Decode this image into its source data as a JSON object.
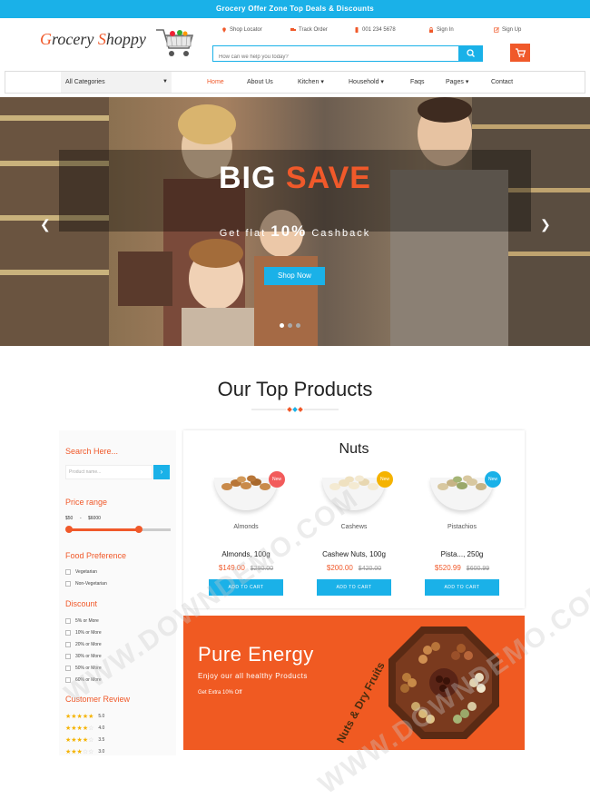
{
  "topbar": {
    "text": "Grocery Offer Zone Top Deals & Discounts"
  },
  "logo": {
    "part1": "G",
    "part2": "rocery ",
    "part3": "S",
    "part4": "hoppy"
  },
  "header_links": {
    "shop_locator": "Shop Locator",
    "track_order": "Track Order",
    "phone": "001 234 5678",
    "sign_in": "Sign In",
    "sign_up": "Sign Up"
  },
  "search": {
    "placeholder": "How can we help you today?"
  },
  "nav": {
    "category": "All Categories",
    "items": [
      "Home",
      "About Us",
      "Kitchen",
      "Household",
      "Faqs",
      "Pages",
      "Contact"
    ]
  },
  "hero": {
    "title_big": "BIG",
    "title_save": "SAVE",
    "sub_prefix": "Get flat",
    "sub_pct": "10%",
    "sub_suffix": "Cashback",
    "button": "Shop Now"
  },
  "section_title": "Our Top Products",
  "sidebar": {
    "search_heading": "Search Here...",
    "search_placeholder": "Product name...",
    "price_heading": "Price range",
    "price_min": "$50",
    "price_dash": "-",
    "price_max": "$6000",
    "food_heading": "Food Preference",
    "food_options": [
      "Vegetarian",
      "Non-Vegetarian"
    ],
    "discount_heading": "Discount",
    "discount_options": [
      "5% or More",
      "10% or More",
      "20% or More",
      "30% or More",
      "50% or More",
      "60% or More"
    ],
    "review_heading": "Customer Review",
    "reviews": [
      "5.0",
      "4.0",
      "3.5",
      "3.0"
    ]
  },
  "products": {
    "heading": "Nuts",
    "badge": "New",
    "button": "ADD TO CART",
    "items": [
      {
        "caption": "Almonds",
        "name": "Almonds, 100g",
        "price": "$149.00",
        "old_price": "$280.00"
      },
      {
        "caption": "Cashews",
        "name": "Cashew Nuts, 100g",
        "price": "$200.00",
        "old_price": "$420.00"
      },
      {
        "caption": "Pistachios",
        "name": "Pista..., 250g",
        "price": "$520.99",
        "old_price": "$600.99"
      }
    ]
  },
  "energy": {
    "title": "Pure Energy",
    "subtitle": "Enjoy our all healthy Products",
    "extra": "Get Extra 10% Off",
    "rotated": "Nuts & Dry Fruits"
  },
  "watermark": "WWW.DOWNDEMO.COM",
  "colors": {
    "accent": "#1ab1e8",
    "brand": "#f0592a"
  }
}
